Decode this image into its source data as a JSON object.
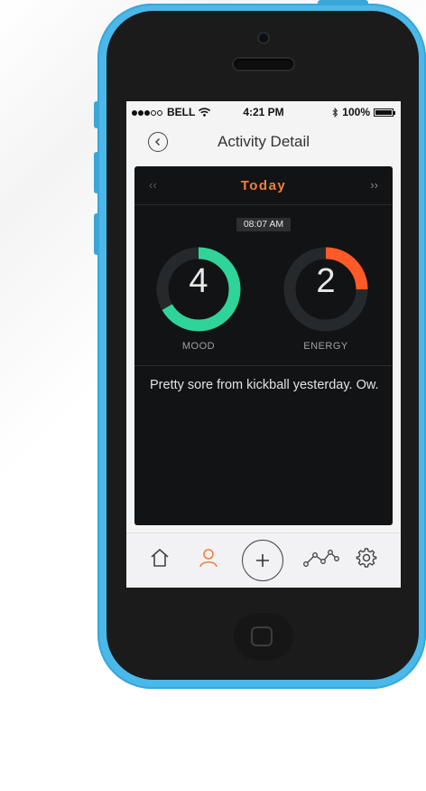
{
  "status_bar": {
    "carrier": "BELL",
    "time": "4:21 PM",
    "battery": "100%",
    "signal_icon": "signal-dots-icon",
    "wifi_icon": "wifi-icon",
    "bluetooth_icon": "bluetooth-icon",
    "battery_icon": "battery-icon"
  },
  "navbar": {
    "title": "Activity Detail",
    "back_icon": "back-chevron-icon"
  },
  "day_selector": {
    "label": "Today",
    "prev": "‹‹",
    "next": "››"
  },
  "entry": {
    "time": "08:07 AM",
    "mood": {
      "label": "MOOD",
      "value": "4",
      "level": 4,
      "max": 6,
      "color": "#2fd49a"
    },
    "energy": {
      "label": "ENERGY",
      "value": "2",
      "level": 2,
      "max": 8,
      "color": "#ff5a28"
    },
    "note": "Pretty sore from kickball yesterday. Ow."
  },
  "tabbar": {
    "items": [
      {
        "name": "home",
        "icon": "home-icon",
        "active": false
      },
      {
        "name": "profile",
        "icon": "person-icon",
        "active": true
      },
      {
        "name": "add",
        "icon": "plus-icon",
        "active": false
      },
      {
        "name": "trends",
        "icon": "trend-line-icon",
        "active": false
      },
      {
        "name": "settings",
        "icon": "gear-icon",
        "active": false
      }
    ],
    "active_color": "#f0803c"
  },
  "colors": {
    "card_bg": "#121314",
    "accent": "#f0803c",
    "device": "#4bb8ea"
  }
}
